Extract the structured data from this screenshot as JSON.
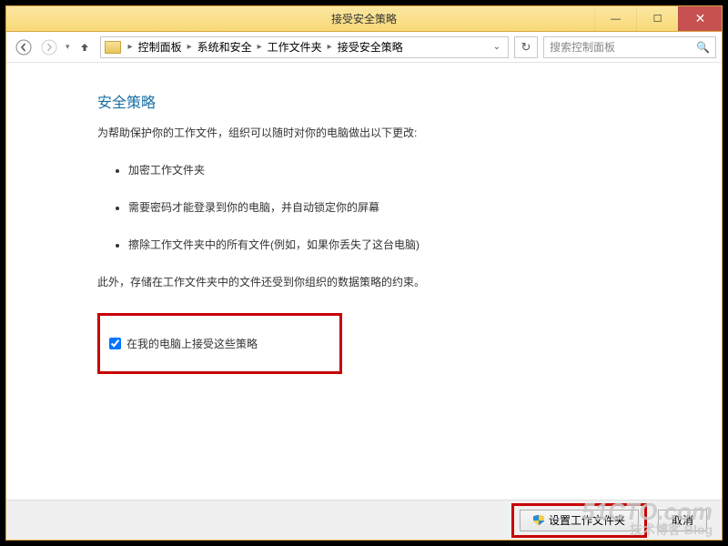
{
  "window": {
    "title": "接受安全策略"
  },
  "nav": {
    "crumbs": [
      "控制面板",
      "系统和安全",
      "工作文件夹",
      "接受安全策略"
    ],
    "search_placeholder": "搜索控制面板"
  },
  "page": {
    "heading": "安全策略",
    "intro": "为帮助保护你的工作文件，组织可以随时对你的电脑做出以下更改:",
    "bullets": [
      "加密工作文件夹",
      "需要密码才能登录到你的电脑，并自动锁定你的屏幕",
      "擦除工作文件夹中的所有文件(例如，如果你丢失了这台电脑)"
    ],
    "note": "此外，存储在工作文件夹中的文件还受到你组织的数据策略的约束。",
    "accept_label": "在我的电脑上接受这些策略",
    "accept_checked": true
  },
  "footer": {
    "primary": "设置工作文件夹",
    "cancel": "取消"
  },
  "watermark": {
    "l1": "51CTO.com",
    "l2": "技术博客  Blog"
  }
}
